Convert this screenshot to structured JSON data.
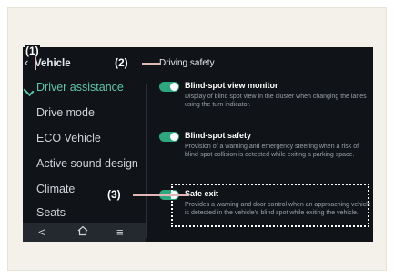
{
  "header": {
    "back_icon": "chevron-left-icon",
    "title": "Vehicle",
    "section": "Driving safety"
  },
  "menu": {
    "items": [
      {
        "label": "Driver assistance",
        "active": true
      },
      {
        "label": "Drive mode",
        "active": false
      },
      {
        "label": "ECO Vehicle",
        "active": false
      },
      {
        "label": "Active sound design",
        "active": false
      },
      {
        "label": "Climate",
        "active": false
      },
      {
        "label": "Seats",
        "active": false
      }
    ]
  },
  "navbar": {
    "back": "<",
    "home_icon": "home-icon",
    "menu_icon": "menu-icon"
  },
  "settings": [
    {
      "title": "Blind-spot view monitor",
      "description": "Display of blind spot view in the cluster when changing the lanes using the turn indicator.",
      "toggle": "on"
    },
    {
      "title": "Blind-spot safety",
      "description": "Provision of a warning and emergency steering when a risk of blind-spot collision is detected while exiting a parking space.",
      "toggle": "on"
    },
    {
      "title": "Safe exit",
      "description": "Provides a warning and door control when an approaching vehicle is detected in the vehicle's blind spot while exiting the vehicle.",
      "toggle": "on"
    }
  ],
  "callouts": {
    "c1": "(1)",
    "c2": "(2)",
    "c3": "(3)"
  },
  "colors": {
    "accent": "#5fc7a7",
    "toggle_on": "#2ea77f",
    "screen_bg": "#101317",
    "callout_line": "#e0b6b6"
  }
}
